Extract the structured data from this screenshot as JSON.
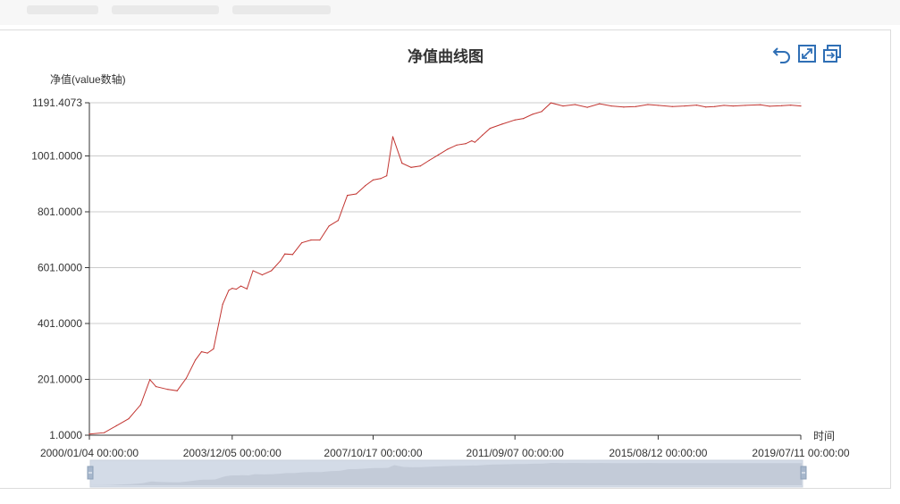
{
  "chart_data": {
    "type": "line",
    "title": "净值曲线图",
    "ylabel": "净值(value数轴)",
    "xlabel": "时间",
    "ylim": [
      1.0,
      1191.4073
    ],
    "y_ticks": [
      "1.0000",
      "201.0000",
      "401.0000",
      "601.0000",
      "801.0000",
      "1001.0000",
      "1191.4073"
    ],
    "x_ticks": [
      "2000/01/04 00:00:00",
      "2003/12/05 00:00:00",
      "2007/10/17 00:00:00",
      "2011/09/07 00:00:00",
      "2015/08/12 00:00:00",
      "2019/07/11 00:00:00"
    ],
    "grid": true,
    "series": [
      {
        "color": "#c23531",
        "x": [
          "2000/01/04",
          "2000/06/01",
          "2000/10/01",
          "2001/02/01",
          "2001/06/01",
          "2001/09/01",
          "2001/11/01",
          "2002/03/01",
          "2002/06/01",
          "2002/09/01",
          "2002/12/01",
          "2003/02/01",
          "2003/04/01",
          "2003/06/01",
          "2003/09/01",
          "2003/11/01",
          "2003/12/05",
          "2004/01/15",
          "2004/03/01",
          "2004/05/01",
          "2004/07/01",
          "2004/10/01",
          "2005/01/01",
          "2005/04/01",
          "2005/05/15",
          "2005/08/01",
          "2005/11/01",
          "2006/02/01",
          "2006/05/01",
          "2006/08/01",
          "2006/11/01",
          "2007/02/01",
          "2007/05/01",
          "2007/08/01",
          "2007/10/17",
          "2008/01/01",
          "2008/03/01",
          "2008/05/01",
          "2008/08/01",
          "2008/11/01",
          "2009/02/01",
          "2009/05/01",
          "2009/08/01",
          "2009/11/01",
          "2010/02/01",
          "2010/05/01",
          "2010/07/01",
          "2010/08/01",
          "2010/09/01",
          "2010/10/15",
          "2011/01/01",
          "2011/05/01",
          "2011/09/07",
          "2011/12/01",
          "2012/03/01",
          "2012/06/01",
          "2012/09/01",
          "2013/01/01",
          "2013/05/01",
          "2013/09/01",
          "2014/01/01",
          "2014/05/01",
          "2014/09/01",
          "2015/01/01",
          "2015/05/01",
          "2015/08/12",
          "2016/01/01",
          "2016/05/01",
          "2016/09/01",
          "2016/12/01",
          "2017/03/01",
          "2017/06/01",
          "2017/09/01",
          "2018/01/01",
          "2018/06/01",
          "2018/09/01",
          "2019/01/01",
          "2019/04/01",
          "2019/07/11"
        ],
        "values": [
          5,
          10,
          35,
          60,
          110,
          200,
          175,
          165,
          160,
          205,
          270,
          300,
          295,
          310,
          470,
          520,
          527,
          524,
          535,
          525,
          590,
          575,
          590,
          625,
          650,
          648,
          690,
          700,
          700,
          750,
          770,
          860,
          865,
          895,
          915,
          920,
          930,
          1070,
          975,
          960,
          965,
          985,
          1005,
          1025,
          1040,
          1045,
          1055,
          1050,
          1060,
          1075,
          1100,
          1115,
          1130,
          1135,
          1150,
          1160,
          1191,
          1180,
          1185,
          1175,
          1188,
          1180,
          1176,
          1178,
          1185,
          1182,
          1178,
          1180,
          1183,
          1176,
          1178,
          1182,
          1180,
          1182,
          1184,
          1179,
          1181,
          1183,
          1180
        ]
      }
    ]
  },
  "toolbox": {
    "items": [
      {
        "name": "restore-icon"
      },
      {
        "name": "zoom-icon"
      },
      {
        "name": "save-image-icon"
      }
    ]
  },
  "dataZoom": {
    "start": 0,
    "end": 100
  }
}
